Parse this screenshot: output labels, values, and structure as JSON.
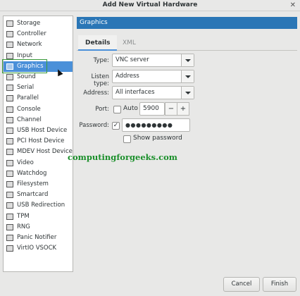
{
  "window": {
    "title": "Add New Virtual Hardware",
    "close_glyph": "✕"
  },
  "sidebar": {
    "items": [
      {
        "label": "Storage",
        "icon": "storage-icon"
      },
      {
        "label": "Controller",
        "icon": "controller-icon"
      },
      {
        "label": "Network",
        "icon": "network-icon"
      },
      {
        "label": "Input",
        "icon": "input-icon"
      },
      {
        "label": "Graphics",
        "icon": "graphics-icon",
        "selected": true
      },
      {
        "label": "Sound",
        "icon": "sound-icon"
      },
      {
        "label": "Serial",
        "icon": "serial-icon"
      },
      {
        "label": "Parallel",
        "icon": "parallel-icon"
      },
      {
        "label": "Console",
        "icon": "console-icon"
      },
      {
        "label": "Channel",
        "icon": "channel-icon"
      },
      {
        "label": "USB Host Device",
        "icon": "usb-icon"
      },
      {
        "label": "PCI Host Device",
        "icon": "pci-icon"
      },
      {
        "label": "MDEV Host Device",
        "icon": "mdev-icon"
      },
      {
        "label": "Video",
        "icon": "video-icon"
      },
      {
        "label": "Watchdog",
        "icon": "watchdog-icon"
      },
      {
        "label": "Filesystem",
        "icon": "filesystem-icon"
      },
      {
        "label": "Smartcard",
        "icon": "smartcard-icon"
      },
      {
        "label": "USB Redirection",
        "icon": "usb-redirection-icon"
      },
      {
        "label": "TPM",
        "icon": "tpm-icon"
      },
      {
        "label": "RNG",
        "icon": "rng-icon"
      },
      {
        "label": "Panic Notifier",
        "icon": "panic-notifier-icon"
      },
      {
        "label": "VirtIO VSOCK",
        "icon": "vsock-icon"
      }
    ]
  },
  "panel": {
    "header": "Graphics",
    "tabs": {
      "details": "Details",
      "xml": "XML"
    },
    "type_label": "Type:",
    "type_value": "VNC server",
    "listen_label": "Listen type:",
    "listen_value": "Address",
    "address_label": "Address:",
    "address_value": "All interfaces",
    "port_label": "Port:",
    "port_auto_label": "Auto",
    "port_auto_checked": false,
    "port_value": "5900",
    "port_minus": "−",
    "port_plus": "+",
    "password_label": "Password:",
    "password_checked": true,
    "password_value": "●●●●●●●●●",
    "show_password_label": "Show password",
    "show_password_checked": false
  },
  "watermark": "computingforgeeks.com",
  "buttons": {
    "cancel": "Cancel",
    "finish": "Finish"
  },
  "colors": {
    "accent": "#2a76b6",
    "selection": "#4a90d9",
    "watermark": "#1a8f2a"
  }
}
